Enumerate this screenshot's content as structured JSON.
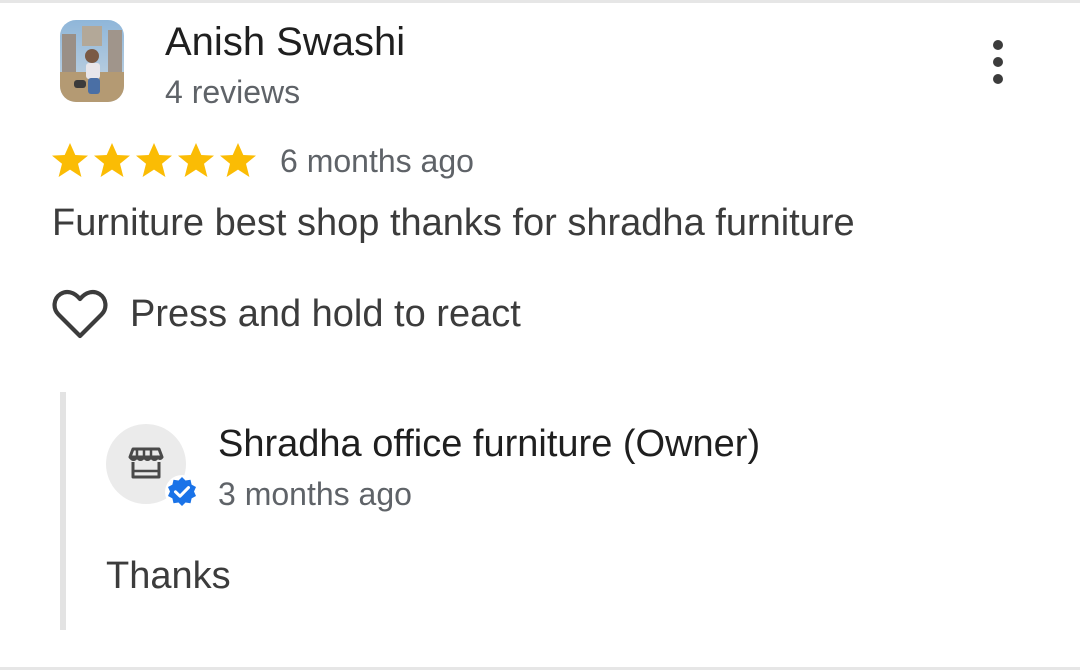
{
  "review": {
    "reviewer_name": "Anish Swashi",
    "reviewer_meta": "4 reviews",
    "rating": 5,
    "rating_max": 5,
    "time": "6 months ago",
    "text": "Furniture best shop thanks for shradha furniture",
    "react_label": "Press and hold to react"
  },
  "owner_reply": {
    "name": "Shradha office furniture (Owner)",
    "time": "3 months ago",
    "text": "Thanks"
  },
  "icons": {
    "avatar": "reviewer-photo",
    "more": "more-vert-icon",
    "star": "star-icon",
    "heart": "heart-outline-icon",
    "store": "storefront-icon",
    "verified": "verified-badge-icon"
  },
  "colors": {
    "star": "#fbbc04",
    "verified": "#1a73e8",
    "text_primary": "#1f1f1f",
    "text_secondary": "#5f6368",
    "text_body": "#3c3c3c"
  }
}
